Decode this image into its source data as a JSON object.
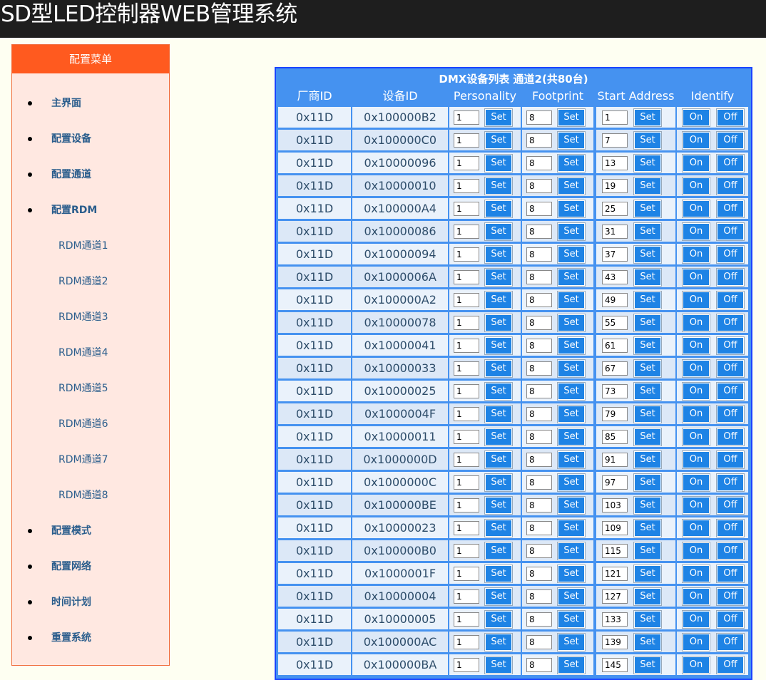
{
  "header": {
    "title": "SD型LED控制器WEB管理系统"
  },
  "sidebar": {
    "title": "配置菜单",
    "items": [
      {
        "label": "主界面",
        "level": "main"
      },
      {
        "label": "配置设备",
        "level": "main"
      },
      {
        "label": "配置通道",
        "level": "main"
      },
      {
        "label": "配置RDM",
        "level": "main"
      },
      {
        "label": "RDM通道1",
        "level": "sub"
      },
      {
        "label": "RDM通道2",
        "level": "sub"
      },
      {
        "label": "RDM通道3",
        "level": "sub"
      },
      {
        "label": "RDM通道4",
        "level": "sub"
      },
      {
        "label": "RDM通道5",
        "level": "sub"
      },
      {
        "label": "RDM通道6",
        "level": "sub"
      },
      {
        "label": "RDM通道7",
        "level": "sub"
      },
      {
        "label": "RDM通道8",
        "level": "sub"
      },
      {
        "label": "配置模式",
        "level": "main"
      },
      {
        "label": "配置网络",
        "level": "main"
      },
      {
        "label": "时间计划",
        "level": "main"
      },
      {
        "label": "重置系统",
        "level": "main"
      }
    ]
  },
  "table": {
    "title": "DMX设备列表 通道2(共80台)",
    "columns": [
      "厂商ID",
      "设备ID",
      "Personality",
      "Footprint",
      "Start Address",
      "Identify"
    ],
    "set_label": "Set",
    "on_label": "On",
    "off_label": "Off",
    "rows": [
      {
        "vendor": "0x11D",
        "device": "0x100000B2",
        "personality": "1",
        "footprint": "8",
        "start": "1"
      },
      {
        "vendor": "0x11D",
        "device": "0x100000C0",
        "personality": "1",
        "footprint": "8",
        "start": "7"
      },
      {
        "vendor": "0x11D",
        "device": "0x10000096",
        "personality": "1",
        "footprint": "8",
        "start": "13"
      },
      {
        "vendor": "0x11D",
        "device": "0x10000010",
        "personality": "1",
        "footprint": "8",
        "start": "19"
      },
      {
        "vendor": "0x11D",
        "device": "0x100000A4",
        "personality": "1",
        "footprint": "8",
        "start": "25"
      },
      {
        "vendor": "0x11D",
        "device": "0x10000086",
        "personality": "1",
        "footprint": "8",
        "start": "31"
      },
      {
        "vendor": "0x11D",
        "device": "0x10000094",
        "personality": "1",
        "footprint": "8",
        "start": "37"
      },
      {
        "vendor": "0x11D",
        "device": "0x1000006A",
        "personality": "1",
        "footprint": "8",
        "start": "43"
      },
      {
        "vendor": "0x11D",
        "device": "0x100000A2",
        "personality": "1",
        "footprint": "8",
        "start": "49"
      },
      {
        "vendor": "0x11D",
        "device": "0x10000078",
        "personality": "1",
        "footprint": "8",
        "start": "55"
      },
      {
        "vendor": "0x11D",
        "device": "0x10000041",
        "personality": "1",
        "footprint": "8",
        "start": "61"
      },
      {
        "vendor": "0x11D",
        "device": "0x10000033",
        "personality": "1",
        "footprint": "8",
        "start": "67"
      },
      {
        "vendor": "0x11D",
        "device": "0x10000025",
        "personality": "1",
        "footprint": "8",
        "start": "73"
      },
      {
        "vendor": "0x11D",
        "device": "0x1000004F",
        "personality": "1",
        "footprint": "8",
        "start": "79"
      },
      {
        "vendor": "0x11D",
        "device": "0x10000011",
        "personality": "1",
        "footprint": "8",
        "start": "85"
      },
      {
        "vendor": "0x11D",
        "device": "0x1000000D",
        "personality": "1",
        "footprint": "8",
        "start": "91"
      },
      {
        "vendor": "0x11D",
        "device": "0x1000000C",
        "personality": "1",
        "footprint": "8",
        "start": "97"
      },
      {
        "vendor": "0x11D",
        "device": "0x100000BE",
        "personality": "1",
        "footprint": "8",
        "start": "103"
      },
      {
        "vendor": "0x11D",
        "device": "0x10000023",
        "personality": "1",
        "footprint": "8",
        "start": "109"
      },
      {
        "vendor": "0x11D",
        "device": "0x100000B0",
        "personality": "1",
        "footprint": "8",
        "start": "115"
      },
      {
        "vendor": "0x11D",
        "device": "0x1000001F",
        "personality": "1",
        "footprint": "8",
        "start": "121"
      },
      {
        "vendor": "0x11D",
        "device": "0x10000004",
        "personality": "1",
        "footprint": "8",
        "start": "127"
      },
      {
        "vendor": "0x11D",
        "device": "0x10000005",
        "personality": "1",
        "footprint": "8",
        "start": "133"
      },
      {
        "vendor": "0x11D",
        "device": "0x100000AC",
        "personality": "1",
        "footprint": "8",
        "start": "139"
      },
      {
        "vendor": "0x11D",
        "device": "0x100000BA",
        "personality": "1",
        "footprint": "8",
        "start": "145"
      }
    ]
  }
}
